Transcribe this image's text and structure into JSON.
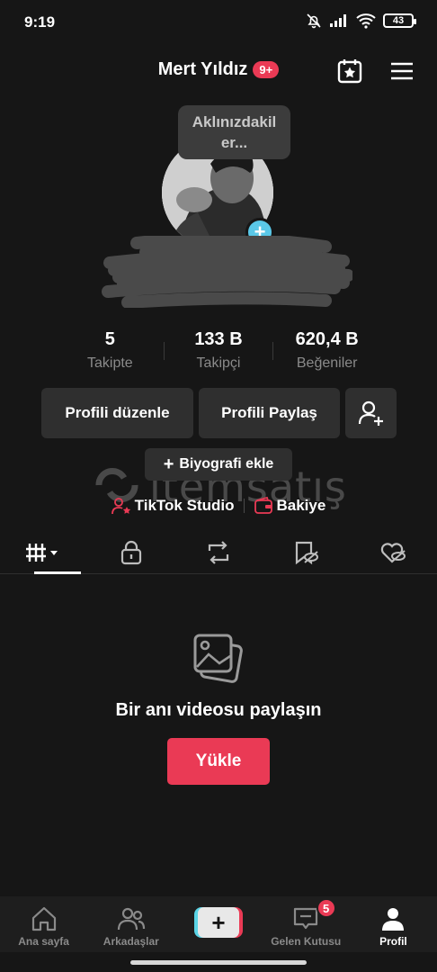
{
  "status_bar": {
    "time": "9:19",
    "battery": "43"
  },
  "header": {
    "name": "Mert Yıldız",
    "notification_badge": "9+"
  },
  "tooltip": {
    "line1": "Aklınızdakil",
    "line2": "er..."
  },
  "stats": [
    {
      "value": "5",
      "label": "Takipte"
    },
    {
      "value": "133 B",
      "label": "Takipçi"
    },
    {
      "value": "620,4 B",
      "label": "Beğeniler"
    }
  ],
  "buttons": {
    "edit_profile": "Profili düzenle",
    "share_profile": "Profili Paylaş",
    "add_bio": "Biyografi ekle"
  },
  "links": {
    "studio": "TikTok Studio",
    "balance": "Bakiye"
  },
  "watermark": {
    "text": "itemsatış"
  },
  "empty_state": {
    "message": "Bir anı videosu paylaşın",
    "upload_label": "Yükle"
  },
  "bottom_nav": {
    "home": "Ana sayfa",
    "friends": "Arkadaşlar",
    "inbox": "Gelen Kutusu",
    "inbox_badge": "5",
    "profile": "Profil"
  },
  "colors": {
    "accent": "#ea3a55",
    "cyan": "#5ac8e8",
    "background": "#161616"
  }
}
